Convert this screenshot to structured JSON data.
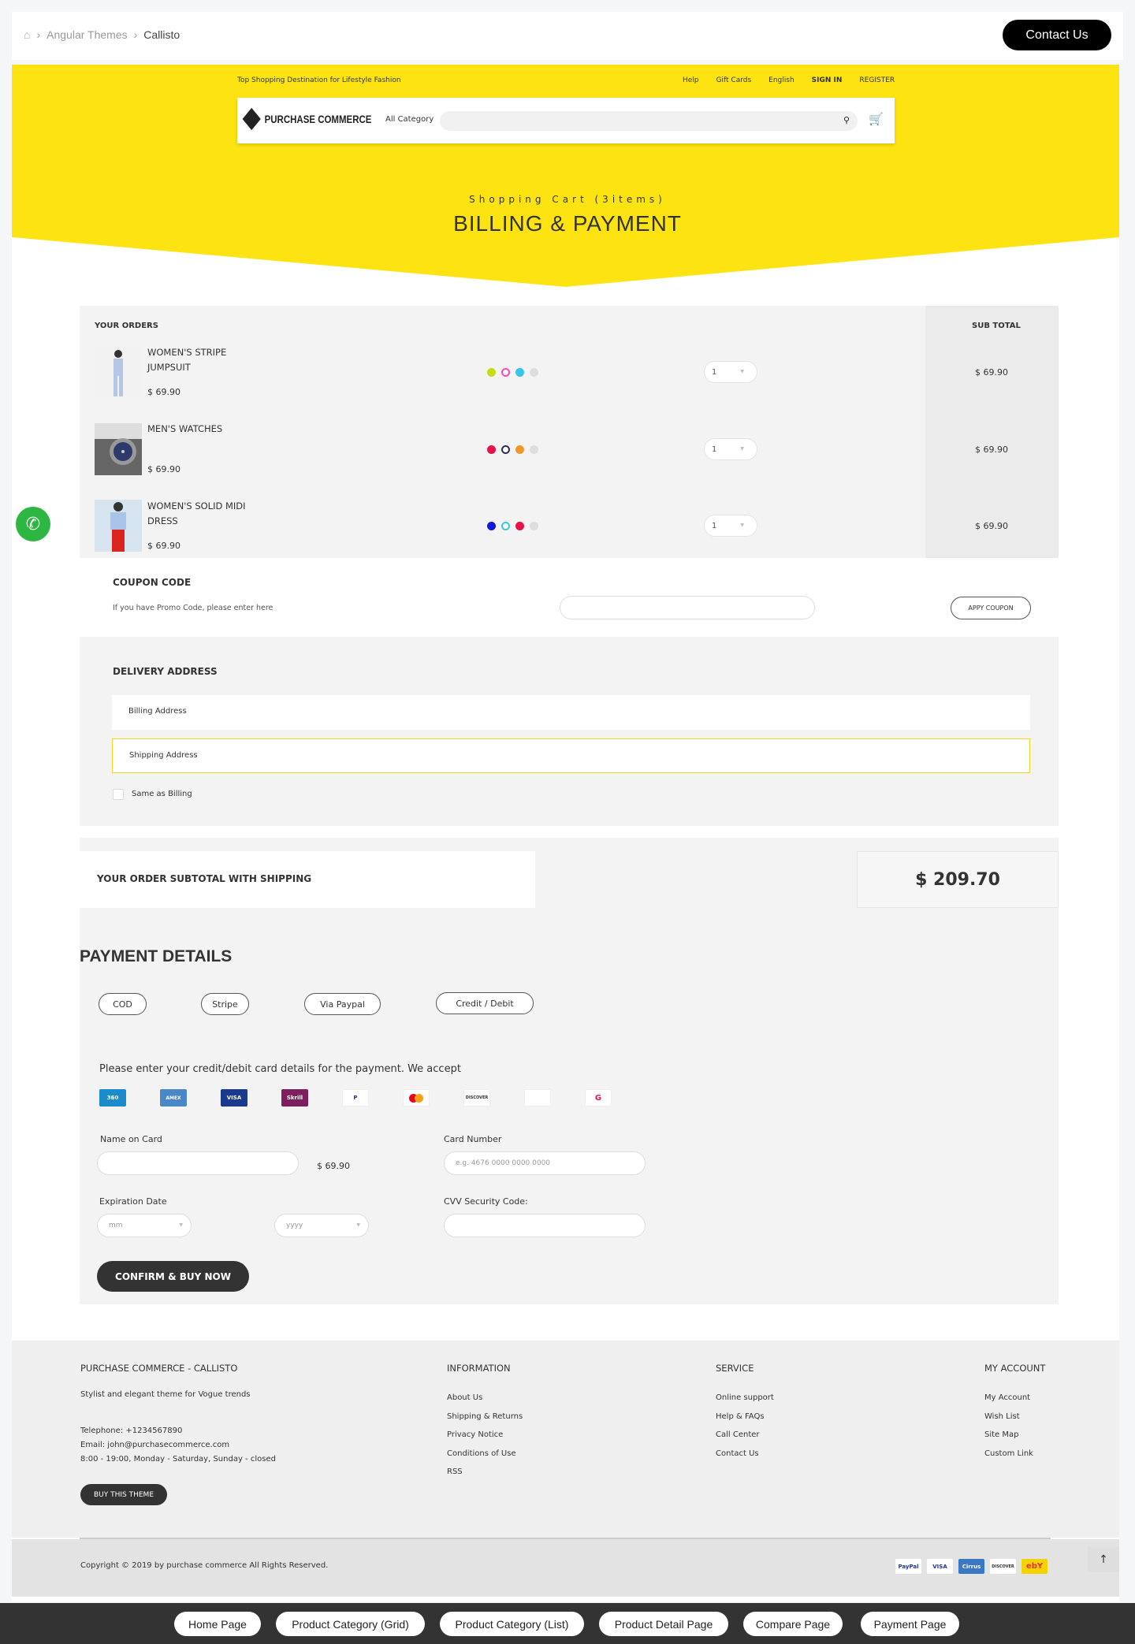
{
  "breadcrumb": {
    "item1": "Angular Themes",
    "current": "Callisto",
    "home_icon": "home-icon",
    "separator": "›"
  },
  "contact_label": "Contact Us",
  "header": {
    "tagline": "Top Shopping Destination for Lifestyle Fashion",
    "links": [
      "Help",
      "Gift Cards",
      "English",
      "SIGN IN",
      "REGISTER"
    ],
    "logo_text": "PURCHASE COMMERCE",
    "category": "All Category",
    "search_placeholder": ""
  },
  "hero": {
    "subtitle": "Shopping Cart (3items)",
    "title": "BILLING & PAYMENT"
  },
  "orders": {
    "heading": "YOUR ORDERS",
    "subtotal_heading": "SUB TOTAL",
    "items": [
      {
        "name": "WOMEN'S STRIPE JUMPSUIT",
        "price": "$ 69.90",
        "qty": "1",
        "subtotal": "$ 69.90",
        "colors": [
          "#c7dc17",
          "#ff46b4",
          "#36c6e8",
          "#dddddd"
        ]
      },
      {
        "name": "MEN'S WATCHES",
        "price": "$ 69.90",
        "qty": "1",
        "subtotal": "$ 69.90",
        "colors": [
          "#e8114a",
          "#2d2e54",
          "#f0972b",
          "#dddddd"
        ]
      },
      {
        "name": "WOMEN'S SOLID MIDI DRESS",
        "price": "$ 69.90",
        "qty": "1",
        "subtotal": "$ 69.90",
        "colors": [
          "#1018d9",
          "#36c6e8",
          "#e8114a",
          "#dddddd"
        ]
      }
    ]
  },
  "coupon": {
    "heading": "COUPON CODE",
    "hint": "If you have Promo Code, please enter here",
    "button": "APPY COUPON",
    "value": ""
  },
  "delivery": {
    "heading": "DELIVERY ADDRESS",
    "billing": "Billing Address",
    "shipping": "Shipping Address",
    "same": "Same as Billing"
  },
  "summary": {
    "label": "YOUR ORDER SUBTOTAL WITH SHIPPING",
    "total": "$ 209.70"
  },
  "payment": {
    "heading": "PAYMENT DETAILS",
    "methods": [
      "COD",
      "Stripe",
      "Via Paypal",
      "Credit / Debit"
    ],
    "accept_text": "Please enter your credit/debit card details for the payment. We accept",
    "cards": [
      "360",
      "AMEX",
      "VISA",
      "Skrill",
      "P",
      "MC",
      "DISCOVER",
      "",
      "G"
    ],
    "name_label": "Name on Card",
    "amount": "$ 69.90",
    "number_label": "Card Number",
    "number_placeholder": "e.g. 4676 0000 0000 0000",
    "exp_label": "Expiration Date",
    "month": "mm",
    "year": "yyyy",
    "cvv_label": "CVV Security Code:",
    "confirm": "CONFIRM & BUY NOW"
  },
  "footer": {
    "brand": "PURCHASE COMMERCE - CALLISTO",
    "desc": "Stylist and elegant theme for Vogue trends",
    "phone": "Telephone: +1234567890",
    "email": "Email: john@purchasecommerce.com",
    "hours": "8:00 - 19:00, Monday - Saturday, Sunday - closed",
    "buy": "BUY THIS THEME",
    "info_h": "INFORMATION",
    "info": [
      "About Us",
      "Shipping & Returns",
      "Privacy Notice",
      "Conditions of Use",
      "RSS"
    ],
    "service_h": "SERVICE",
    "service": [
      "Online support",
      "Help & FAQs",
      "Call Center",
      "Contact Us"
    ],
    "account_h": "MY ACCOUNT",
    "account": [
      "My Account",
      "Wish List",
      "Site Map",
      "Custom Link"
    ],
    "copyright": "Copyright © 2019 by purchase commerce All Rights Reserved.",
    "pay_icons": [
      "PayPal",
      "VISA",
      "Cirrus",
      "DISCOVER",
      "ebY"
    ]
  },
  "bottom_nav": [
    "Home Page",
    "Product Category (Grid)",
    "Product Category (List)",
    "Product Detail Page",
    "Compare Page",
    "Payment Page"
  ]
}
